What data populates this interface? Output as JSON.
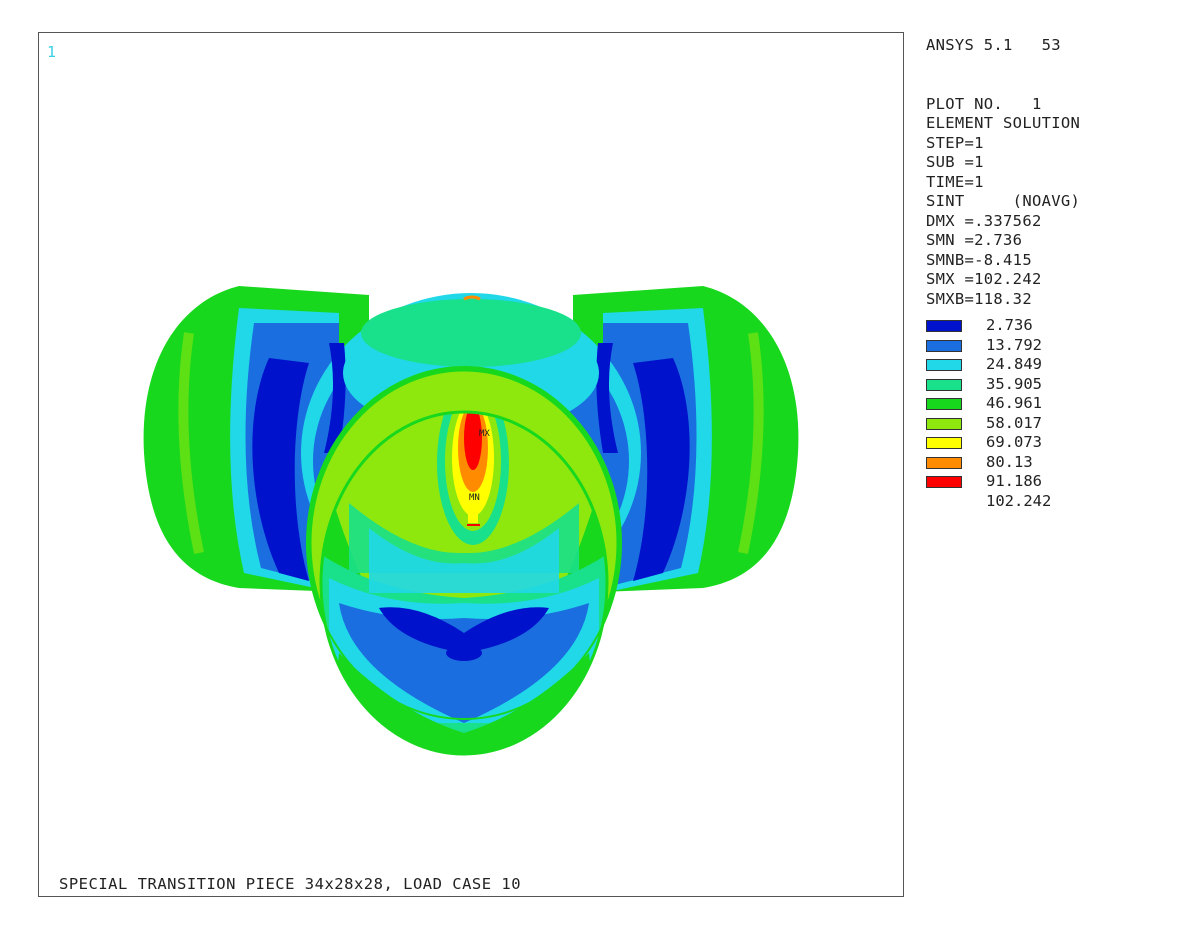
{
  "viewport": {
    "window_number": "1",
    "caption": "SPECIAL TRANSITION PIECE 34x28x28, LOAD CASE 10",
    "markers": {
      "max": "MX",
      "min": "MN"
    }
  },
  "info": {
    "header": "ANSYS 5.1   53",
    "lines": [
      "PLOT NO.   1",
      "ELEMENT SOLUTION",
      "STEP=1",
      "SUB =1",
      "TIME=1",
      "SINT     (NOAVG)",
      "DMX =.337562",
      "SMN =2.736",
      "SMNB=-8.415",
      "SMX =102.242",
      "SMXB=118.32"
    ]
  },
  "legend": [
    {
      "value": "2.736",
      "color": "#0012cc"
    },
    {
      "value": "13.792",
      "color": "#1a6ee0"
    },
    {
      "value": "24.849",
      "color": "#20d8e8"
    },
    {
      "value": "35.905",
      "color": "#19e08a"
    },
    {
      "value": "46.961",
      "color": "#18d81e"
    },
    {
      "value": "58.017",
      "color": "#8ee80e"
    },
    {
      "value": "69.073",
      "color": "#ffff00"
    },
    {
      "value": "80.13",
      "color": "#ff8c00"
    },
    {
      "value": "91.186",
      "color": "#ff0000"
    },
    {
      "value": "102.242",
      "color": ""
    }
  ]
}
